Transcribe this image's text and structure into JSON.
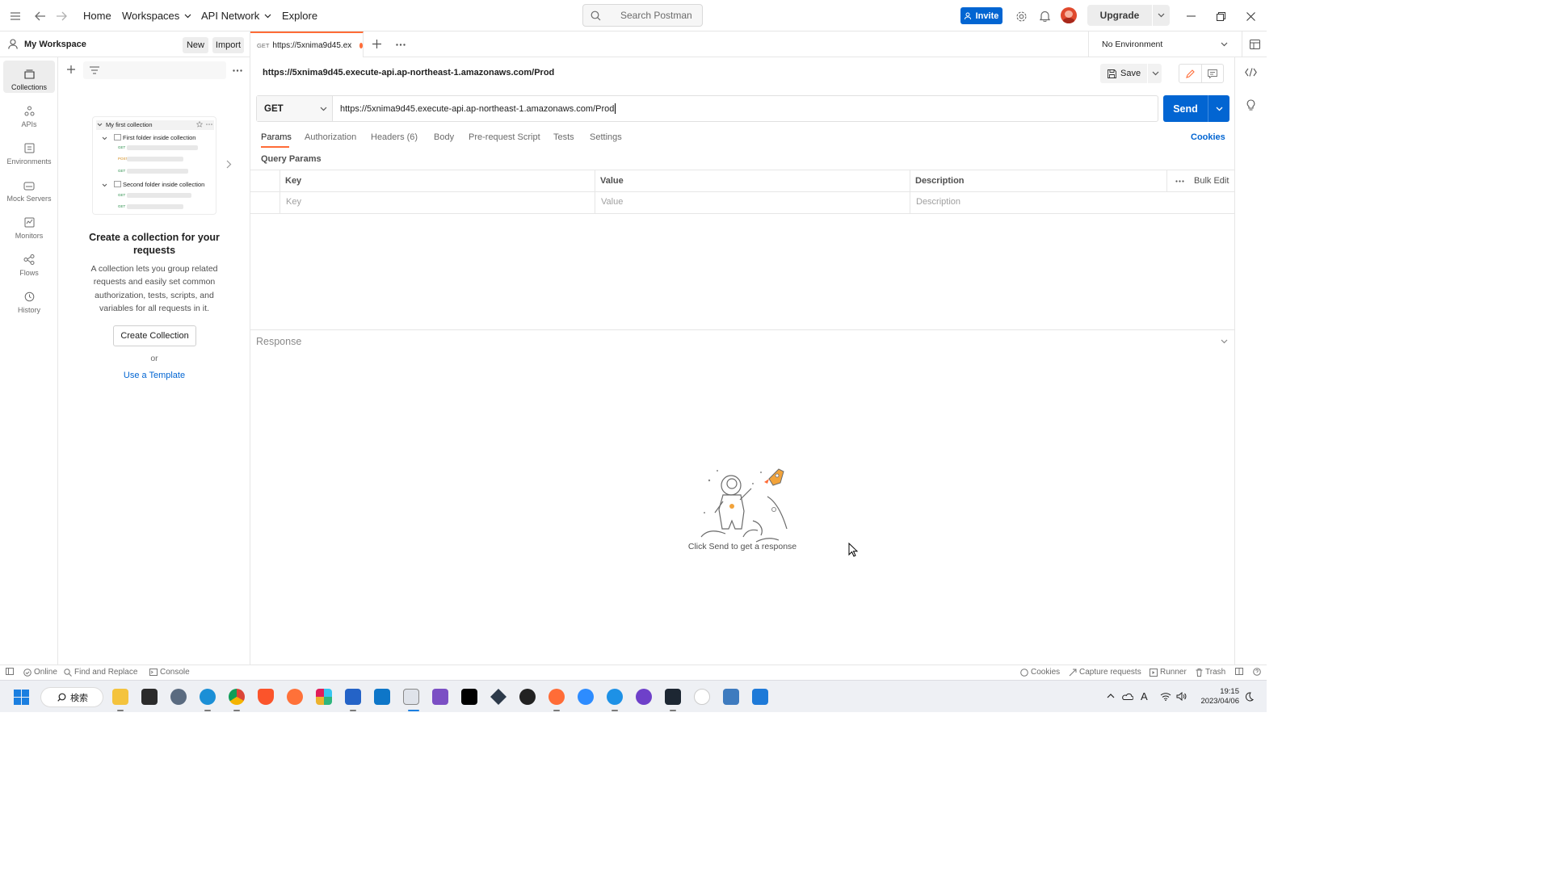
{
  "topbar": {
    "nav": [
      "Home",
      "Workspaces",
      "API Network",
      "Explore"
    ],
    "search_placeholder": "Search Postman",
    "invite": "Invite",
    "upgrade": "Upgrade"
  },
  "workspace": {
    "name": "My Workspace",
    "new_label": "New",
    "import_label": "Import"
  },
  "rail": [
    "Collections",
    "APIs",
    "Environments",
    "Mock Servers",
    "Monitors",
    "Flows",
    "History"
  ],
  "collections_empty": {
    "preview": {
      "collection": "My first collection",
      "folder1": "First folder inside collection",
      "folder2": "Second folder inside collection",
      "methods": [
        "GET",
        "POST",
        "GET",
        "GET",
        "GET"
      ]
    },
    "heading": "Create a collection for your requests",
    "body": "A collection lets you group related requests and easily set common authorization, tests, scripts, and variables for all requests in it.",
    "create_button": "Create Collection",
    "or": "or",
    "template_link": "Use a Template"
  },
  "tab": {
    "method": "GET",
    "title": "https://5xnima9d45.ex"
  },
  "environment": "No Environment",
  "request": {
    "title": "https://5xnima9d45.execute-api.ap-northeast-1.amazonaws.com/Prod",
    "save": "Save",
    "method": "GET",
    "url": "https://5xnima9d45.execute-api.ap-northeast-1.amazonaws.com/Prod",
    "send": "Send",
    "tabs": [
      "Params",
      "Authorization",
      "Headers (6)",
      "Body",
      "Pre-request Script",
      "Tests",
      "Settings"
    ],
    "cookies": "Cookies",
    "query_params_label": "Query Params",
    "table_headers": {
      "key": "Key",
      "value": "Value",
      "description": "Description",
      "bulk_edit": "Bulk Edit"
    },
    "placeholders": {
      "key": "Key",
      "value": "Value",
      "description": "Description"
    }
  },
  "response": {
    "label": "Response",
    "hint": "Click Send to get a response"
  },
  "statusbar": {
    "left": [
      "Online",
      "Find and Replace",
      "Console"
    ],
    "right": [
      "Cookies",
      "Capture requests",
      "Runner",
      "Trash"
    ]
  },
  "taskbar": {
    "search": "検索",
    "time": "19:15",
    "date": "2023/04/06",
    "ime": "A"
  },
  "colors": {
    "accent": "#ff6c37",
    "primary": "#0265d2",
    "link": "#0265d2"
  }
}
